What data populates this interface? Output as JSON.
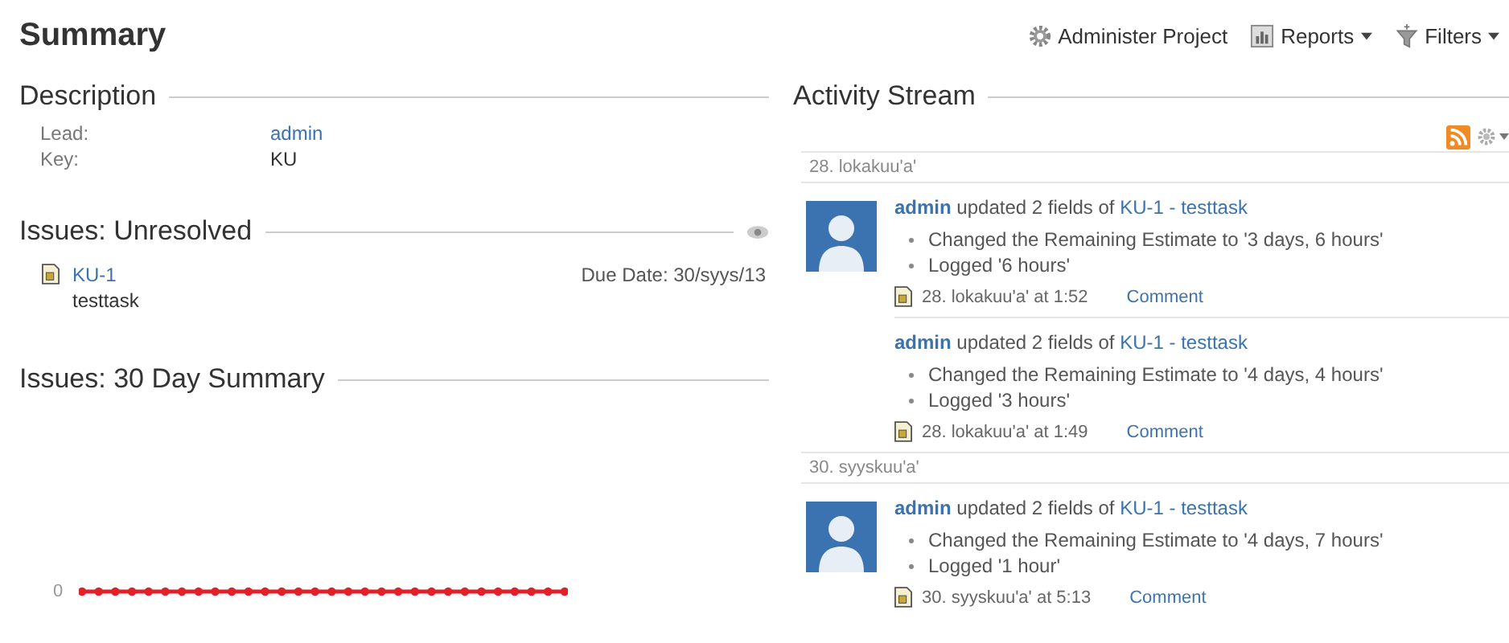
{
  "page": {
    "title": "Summary"
  },
  "actions": [
    {
      "kind": "gear",
      "label": "Administer Project",
      "dropdown": false
    },
    {
      "kind": "chart",
      "label": "Reports",
      "dropdown": true
    },
    {
      "kind": "filter",
      "label": "Filters",
      "dropdown": true
    }
  ],
  "description": {
    "heading": "Description",
    "fields": [
      {
        "label": "Lead:",
        "value": "admin",
        "link": true
      },
      {
        "label": "Key:",
        "value": "KU",
        "link": false
      }
    ]
  },
  "unresolved": {
    "heading": "Issues: Unresolved",
    "issues": [
      {
        "key": "KU-1",
        "summary": "testtask",
        "due": "Due Date: 30/syys/13"
      }
    ]
  },
  "summary_30": {
    "heading": "Issues: 30 Day Summary",
    "y_tick": "0"
  },
  "activity": {
    "heading": "Activity Stream",
    "groups": [
      {
        "date": "28. lokakuu'a'",
        "entries": [
          {
            "avatar": true,
            "user": "admin",
            "action": "updated 2 fields of",
            "link": "KU-1 - testtask",
            "bullets": [
              "Changed the Remaining Estimate to '3 days, 6 hours'",
              "Logged '6 hours'"
            ],
            "time": "28. lokakuu'a' at 1:52",
            "comment": "Comment"
          },
          {
            "avatar": false,
            "user": "admin",
            "action": "updated 2 fields of",
            "link": "KU-1 - testtask",
            "bullets": [
              "Changed the Remaining Estimate to '4 days, 4 hours'",
              "Logged '3 hours'"
            ],
            "time": "28. lokakuu'a' at 1:49",
            "comment": "Comment"
          }
        ]
      },
      {
        "date": "30. syyskuu'a'",
        "entries": [
          {
            "avatar": true,
            "user": "admin",
            "action": "updated 2 fields of",
            "link": "KU-1 - testtask",
            "bullets": [
              "Changed the Remaining Estimate to '4 days, 7 hours'",
              "Logged '1 hour'"
            ],
            "time": "30. syyskuu'a' at 5:13",
            "comment": "Comment"
          }
        ]
      }
    ]
  }
}
